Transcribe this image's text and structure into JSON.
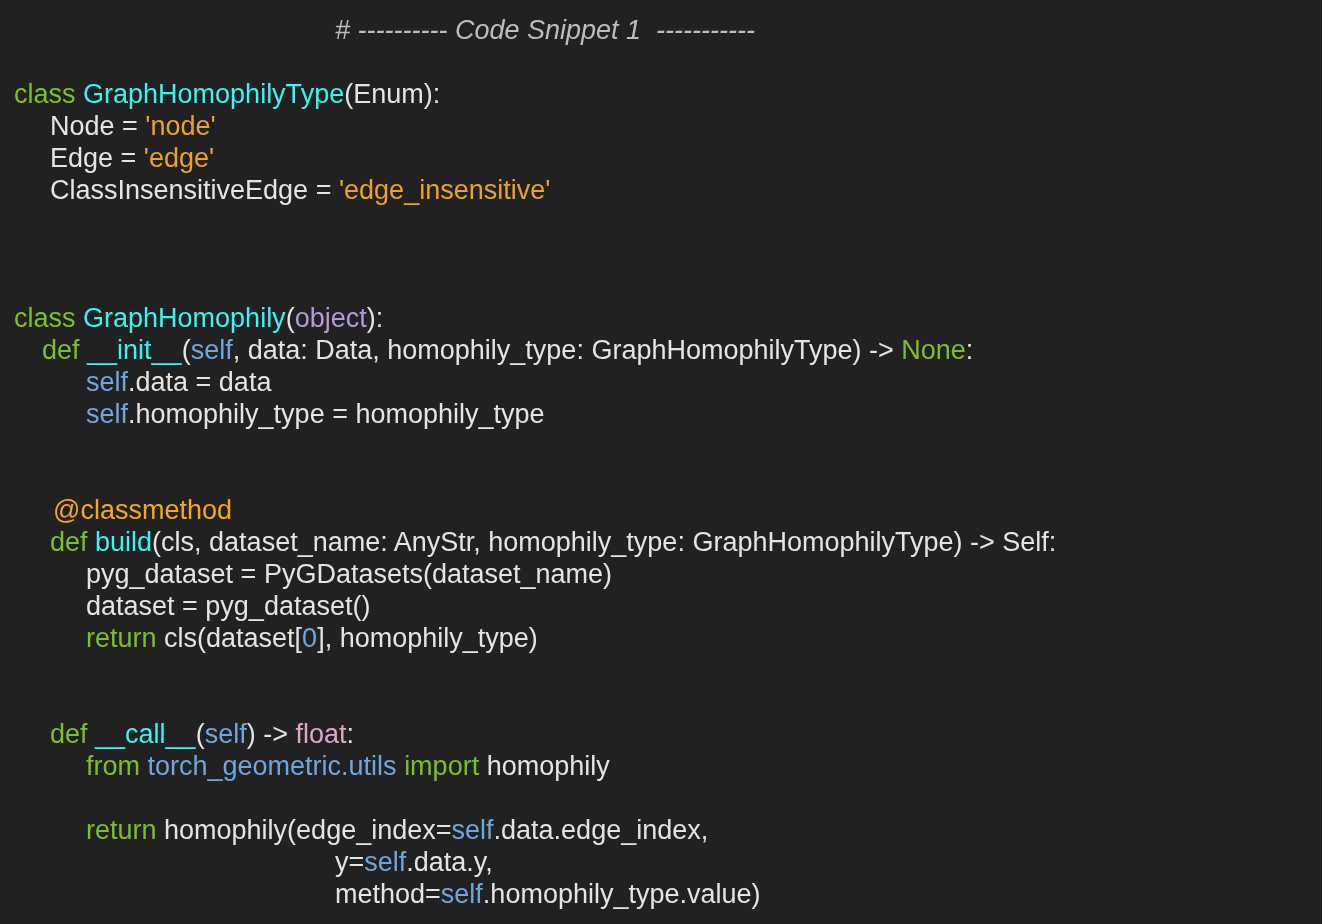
{
  "code": {
    "lines": [
      {
        "kind": "heading",
        "tokens": [
          {
            "kind": "comment",
            "text": "# ---------- Code Snippet 1  -----------"
          }
        ]
      },
      {
        "kind": "class-first",
        "tokens": [
          {
            "kind": "keyword",
            "text": "class "
          },
          {
            "kind": "name",
            "text": "GraphHomophilyType"
          },
          {
            "kind": "plain",
            "text": "(Enum):"
          }
        ]
      },
      {
        "kind": "member",
        "tokens": [
          {
            "kind": "plain",
            "text": "Node = "
          },
          {
            "kind": "string",
            "text": "'node'"
          }
        ]
      },
      {
        "kind": "member",
        "tokens": [
          {
            "kind": "plain",
            "text": "Edge = "
          },
          {
            "kind": "string",
            "text": "'edge'"
          }
        ]
      },
      {
        "kind": "member",
        "tokens": [
          {
            "kind": "plain",
            "text": "ClassInsensitiveEdge = "
          },
          {
            "kind": "string",
            "text": "'edge_insensitive'"
          }
        ]
      },
      {
        "kind": "class",
        "tokens": [
          {
            "kind": "keyword",
            "text": "class "
          },
          {
            "kind": "name",
            "text": "GraphHomophily"
          },
          {
            "kind": "plain",
            "text": "("
          },
          {
            "kind": "builtin",
            "text": "object"
          },
          {
            "kind": "plain",
            "text": "):"
          }
        ]
      },
      {
        "kind": "init-def",
        "tokens": [
          {
            "kind": "keyword",
            "text": "def "
          },
          {
            "kind": "name",
            "text": "__init__"
          },
          {
            "kind": "plain",
            "text": "("
          },
          {
            "kind": "self",
            "text": "self"
          },
          {
            "kind": "plain",
            "text": ", data: Data, homophily_type: GraphHomophilyType) -> "
          },
          {
            "kind": "keyword",
            "text": "None"
          },
          {
            "kind": "plain",
            "text": ":"
          }
        ]
      },
      {
        "kind": "body",
        "tokens": [
          {
            "kind": "self",
            "text": "self"
          },
          {
            "kind": "plain",
            "text": ".data = data"
          }
        ]
      },
      {
        "kind": "body",
        "tokens": [
          {
            "kind": "self",
            "text": "self"
          },
          {
            "kind": "plain",
            "text": ".homophily_type = homophily_type"
          }
        ]
      },
      {
        "kind": "decorator",
        "tokens": [
          {
            "kind": "decorator",
            "text": "@classmethod"
          }
        ]
      },
      {
        "kind": "member",
        "tokens": [
          {
            "kind": "keyword",
            "text": "def "
          },
          {
            "kind": "name",
            "text": "build"
          },
          {
            "kind": "plain",
            "text": "(cls, dataset_name: AnyStr, homophily_type: GraphHomophilyType) -> Self:"
          }
        ]
      },
      {
        "kind": "body",
        "tokens": [
          {
            "kind": "plain",
            "text": "pyg_dataset = PyGDatasets(dataset_name)"
          }
        ]
      },
      {
        "kind": "body",
        "tokens": [
          {
            "kind": "plain",
            "text": "dataset = pyg_dataset()"
          }
        ]
      },
      {
        "kind": "body",
        "tokens": [
          {
            "kind": "keyword",
            "text": "return "
          },
          {
            "kind": "plain",
            "text": "cls(dataset["
          },
          {
            "kind": "self",
            "text": "0"
          },
          {
            "kind": "plain",
            "text": "], homophily_type)"
          }
        ]
      },
      {
        "kind": "method-spaced",
        "tokens": [
          {
            "kind": "keyword",
            "text": "def "
          },
          {
            "kind": "name",
            "text": "__call__"
          },
          {
            "kind": "plain",
            "text": "("
          },
          {
            "kind": "self",
            "text": "self"
          },
          {
            "kind": "plain",
            "text": ") -> "
          },
          {
            "kind": "type",
            "text": "float"
          },
          {
            "kind": "plain",
            "text": ":"
          }
        ]
      },
      {
        "kind": "body",
        "tokens": [
          {
            "kind": "keyword",
            "text": "from "
          },
          {
            "kind": "self",
            "text": "torch_geometric.utils "
          },
          {
            "kind": "keyword",
            "text": "import "
          },
          {
            "kind": "plain",
            "text": "homophily"
          }
        ]
      },
      {
        "kind": "body-spaced",
        "tokens": [
          {
            "kind": "keyword",
            "text": "return "
          },
          {
            "kind": "plain",
            "text": "homophily(edge_index="
          },
          {
            "kind": "self",
            "text": "self"
          },
          {
            "kind": "plain",
            "text": ".data.edge_index,"
          }
        ]
      },
      {
        "kind": "continuation",
        "tokens": [
          {
            "kind": "plain",
            "text": "y="
          },
          {
            "kind": "self",
            "text": "self"
          },
          {
            "kind": "plain",
            "text": ".data.y,"
          }
        ]
      },
      {
        "kind": "continuation",
        "tokens": [
          {
            "kind": "plain",
            "text": "method="
          },
          {
            "kind": "self",
            "text": "self"
          },
          {
            "kind": "plain",
            "text": ".homophily_type.value)"
          }
        ]
      }
    ]
  }
}
